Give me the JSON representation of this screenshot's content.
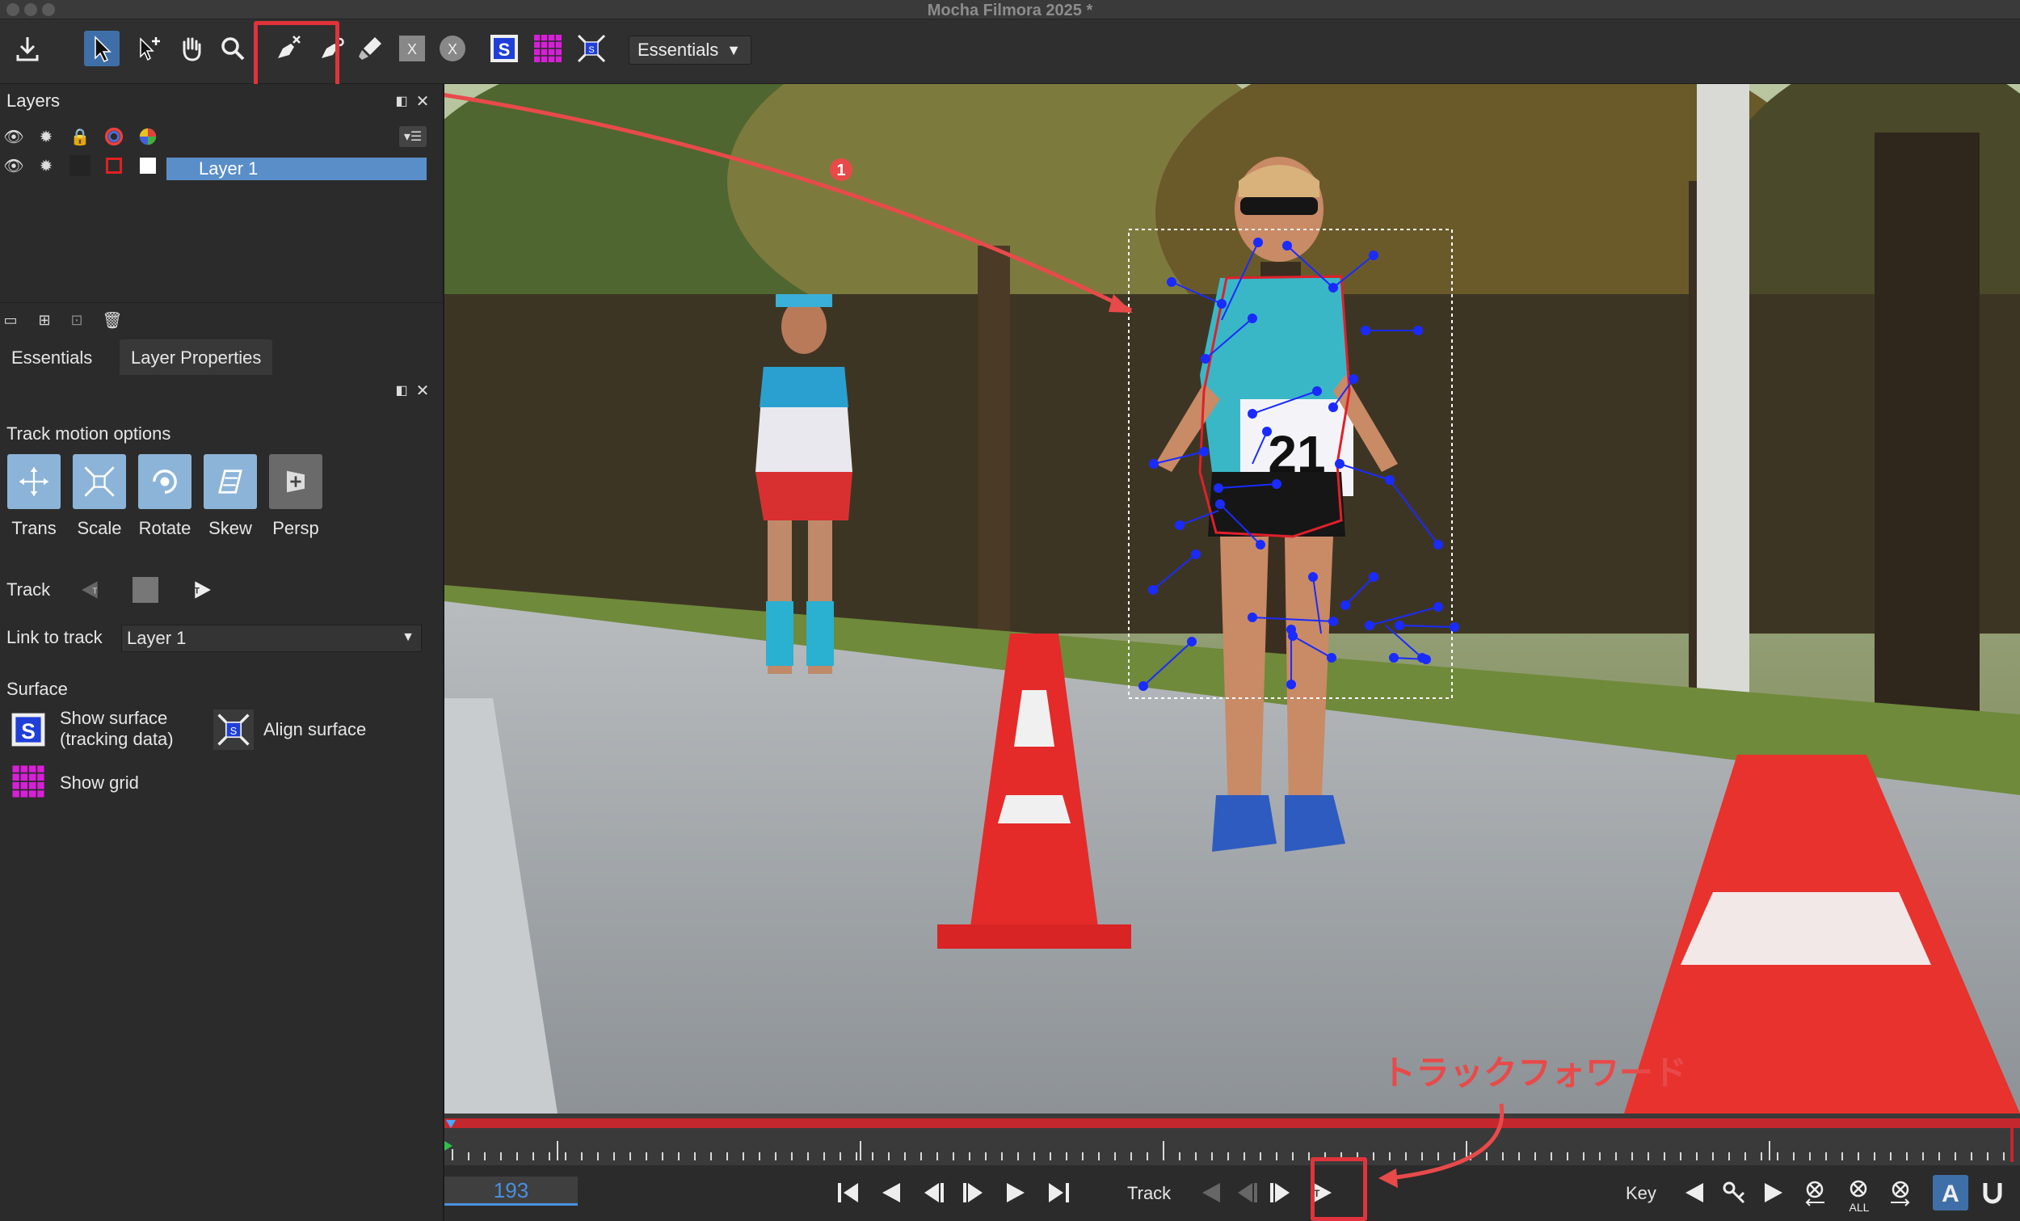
{
  "window": {
    "title": "Mocha Filmora 2025 *"
  },
  "toolbar": {
    "tools": [
      {
        "name": "export-icon"
      },
      {
        "name": "select-icon",
        "active": true
      },
      {
        "name": "add-point-icon"
      },
      {
        "name": "hand-icon"
      },
      {
        "name": "zoom-icon"
      },
      {
        "name": "xspline-pen-icon"
      },
      {
        "name": "bezier-pen-icon"
      },
      {
        "name": "brush-icon"
      },
      {
        "name": "x-spline-layer-icon"
      },
      {
        "name": "bezier-layer-icon"
      },
      {
        "name": "show-surface-icon"
      },
      {
        "name": "show-grid-icon"
      },
      {
        "name": "align-surface-icon"
      }
    ],
    "workspace": "Essentials"
  },
  "layers_panel": {
    "title": "Layers",
    "layers": [
      {
        "name": "Layer 1"
      }
    ]
  },
  "tabs": [
    {
      "label": "Essentials"
    },
    {
      "label": "Layer Properties",
      "selected": true
    }
  ],
  "track_motion": {
    "title": "Track motion options",
    "options": [
      {
        "label": "Trans",
        "on": true
      },
      {
        "label": "Scale",
        "on": true
      },
      {
        "label": "Rotate",
        "on": true
      },
      {
        "label": "Skew",
        "on": true
      },
      {
        "label": "Persp",
        "on": false
      }
    ]
  },
  "track_label": "Track",
  "link_to_track": {
    "label": "Link to track",
    "value": "Layer 1"
  },
  "surface": {
    "title": "Surface",
    "show_surface_line1": "Show surface",
    "show_surface_line2": "(tracking data)",
    "align_surface": "Align surface",
    "show_grid": "Show grid"
  },
  "transport": {
    "frame": "193",
    "track_label": "Track",
    "key_label": "Key",
    "all_label": "ALL"
  },
  "annotations": {
    "step_badge": "1",
    "track_forward_jp": "トラックフォワード"
  },
  "colors": {
    "accent_blue": "#4a8fe0",
    "highlight_red": "#e0333b",
    "layer_selected": "#5a8ec8",
    "spline_blue": "#1a2bff",
    "spline_red": "#e0202a"
  }
}
